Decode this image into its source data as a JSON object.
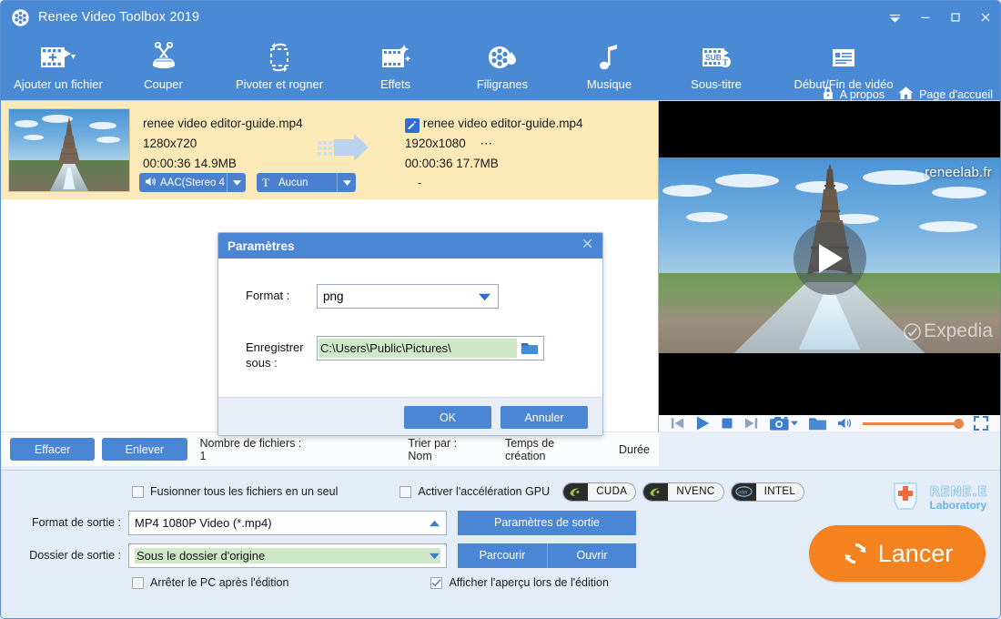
{
  "window": {
    "title": "Renee Video Toolbox 2019",
    "logo_icon": "film-reel-icon",
    "controls": [
      {
        "name": "menu-chevron-button",
        "icon": "chevron-down-icon"
      },
      {
        "name": "minimize-button",
        "icon": "minimize-icon"
      },
      {
        "name": "maximize-button",
        "icon": "maximize-icon"
      },
      {
        "name": "close-button",
        "icon": "close-icon"
      }
    ]
  },
  "toolbar": {
    "items": [
      {
        "label": "Ajouter un fichier",
        "icon": "add-file-icon",
        "has_dropdown": true
      },
      {
        "label": "Couper",
        "icon": "scissors-icon",
        "has_dropdown": false
      },
      {
        "label": "Pivoter et rogner",
        "icon": "rotate-crop-icon",
        "has_dropdown": false
      },
      {
        "label": "Effets",
        "icon": "effects-icon",
        "has_dropdown": false
      },
      {
        "label": "Filigranes",
        "icon": "watermark-icon",
        "has_dropdown": false
      },
      {
        "label": "Musique",
        "icon": "music-note-icon",
        "has_dropdown": false
      },
      {
        "label": "Sous-titre",
        "icon": "subtitle-icon",
        "has_dropdown": false
      },
      {
        "label": "Début/Fin de vidéo",
        "icon": "video-intro-outro-icon",
        "has_dropdown": false
      }
    ],
    "about": {
      "label": "A propos",
      "icon": "lock-icon"
    },
    "homepage": {
      "label": "Page d'accueil",
      "icon": "home-icon"
    }
  },
  "file_list": {
    "row": {
      "thumbnail_icon": "video-thumbnail",
      "source": {
        "name": "renee video editor-guide.mp4",
        "resolution": "1280x720",
        "duration_size": "00:00:36  14.9MB"
      },
      "arrow_icon": "transcode-arrow-icon",
      "target": {
        "edit_icon": "edit-pencil-icon",
        "name": "renee video editor-guide.mp4",
        "resolution": "1920x1080",
        "ellipsis": "⋯",
        "duration_size": "00:00:36  17.7MB"
      },
      "audio_track": {
        "icon": "speaker-icon",
        "label": "AAC(Stereo 4",
        "caret": "caret-down-icon"
      },
      "subtitle_track": {
        "icon": "text-t-icon",
        "label": "Aucun",
        "caret": "caret-down-icon"
      },
      "extra": "-"
    }
  },
  "list_toolbar": {
    "clear_label": "Effacer",
    "remove_label": "Enlever",
    "file_count": "Nombre de fichiers : 1",
    "sort_by": "Trier par :  Nom",
    "sort_creation": "Temps de création",
    "sort_duration": "Durée"
  },
  "preview": {
    "watermark_top": "reneelab.fr",
    "watermark_brand": "Expedia",
    "play_icon": "play-triangle-icon",
    "controls": [
      {
        "name": "previous-button",
        "icon": "skip-previous-icon"
      },
      {
        "name": "play-button",
        "icon": "play-icon"
      },
      {
        "name": "stop-button",
        "icon": "stop-icon"
      },
      {
        "name": "next-button",
        "icon": "skip-next-icon"
      },
      {
        "name": "snapshot-button",
        "icon": "camera-icon"
      },
      {
        "name": "open-folder-button",
        "icon": "folder-icon"
      },
      {
        "name": "volume-button",
        "icon": "speaker-icon"
      },
      {
        "name": "fullscreen-button",
        "icon": "fullscreen-icon"
      }
    ],
    "volume_percent": 100
  },
  "settings": {
    "merge_label": "Fusionner tous les fichiers en un seul",
    "merge_checked": false,
    "gpu_label": "Activer l'accélération GPU",
    "gpu_checked": false,
    "gpu_badges": [
      {
        "text": "CUDA",
        "logo": "nvidia-logo-icon"
      },
      {
        "text": "NVENC",
        "logo": "nvidia-logo-icon"
      },
      {
        "text": "INTEL",
        "logo": "intel-logo-icon"
      }
    ],
    "format_label": "Format de sortie :",
    "format_value": "MP4 1080P Video (*.mp4)",
    "format_caret": "caret-up-icon",
    "output_settings_label": "Paramètres de sortie",
    "folder_label": "Dossier de sortie :",
    "folder_prefix": ":",
    "folder_value": "Sous le dossier d'origine",
    "folder_caret": "caret-down-icon",
    "browse_label": "Parcourir",
    "open_label": "Ouvrir",
    "shutdown_label": "Arrêter le PC après l'édition",
    "shutdown_checked": false,
    "preview_label": "Afficher l'aperçu lors de l'édition",
    "preview_checked": true,
    "start_label": "Lancer",
    "start_icon": "refresh-circle-icon",
    "brand_name": "RENE.E",
    "brand_sub": "Laboratory",
    "brand_icon": "rene-cross-logo-icon"
  },
  "dialog": {
    "title": "Paramètres",
    "close_icon": "close-icon",
    "format_label": "Format :",
    "format_value": "png",
    "format_caret": "caret-down-icon",
    "saveas_label": "Enregistrer sous :",
    "saveas_value": "C:\\Users\\Public\\Pictures\\",
    "folder_icon": "folder-browse-icon",
    "ok_label": "OK",
    "cancel_label": "Annuler"
  },
  "colors": {
    "accent_blue": "#4a86d4",
    "title_blue": "#4a8ad4",
    "row_yellow": "#fce9b8",
    "field_green": "#cfe8c8",
    "orange": "#f3821f"
  }
}
